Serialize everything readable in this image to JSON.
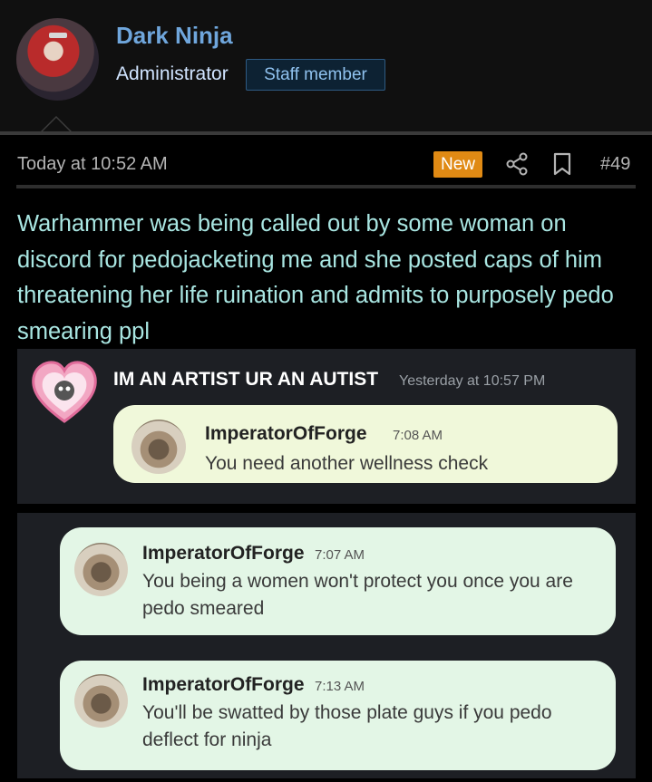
{
  "user": {
    "name": "Dark Ninja",
    "role": "Administrator",
    "badge": "Staff member"
  },
  "post": {
    "timestamp": "Today at 10:52 AM",
    "new_badge": "New",
    "number": "#49",
    "text": "Warhammer was being called out by some woman on discord for pedojacketing me and she posted caps of him threatening her life ruination and admits to purposely pedo smearing ppl"
  },
  "screenshot1": {
    "author": "IM AN ARTIST UR AN AUTIST",
    "time": "Yesterday at 10:57 PM",
    "message": {
      "author": "ImperatorOfForge",
      "time": "7:08 AM",
      "text": "You need another wellness check"
    }
  },
  "screenshot2": {
    "messages": [
      {
        "author": "ImperatorOfForge",
        "time": "7:07 AM",
        "text": "You being a women won't protect you once you are pedo smeared"
      },
      {
        "author": "ImperatorOfForge",
        "time": "7:13 AM",
        "text": "You'll be swatted by those plate guys if you pedo deflect for ninja"
      }
    ]
  },
  "icons": {
    "share": "share-icon",
    "bookmark": "bookmark-icon"
  },
  "colors": {
    "username": "#6fa6dc",
    "post_text": "#a9e6e2",
    "new_badge": "#e08a14",
    "bubble_light": "#f0f8da",
    "bubble_mint": "#e3f6e6"
  }
}
